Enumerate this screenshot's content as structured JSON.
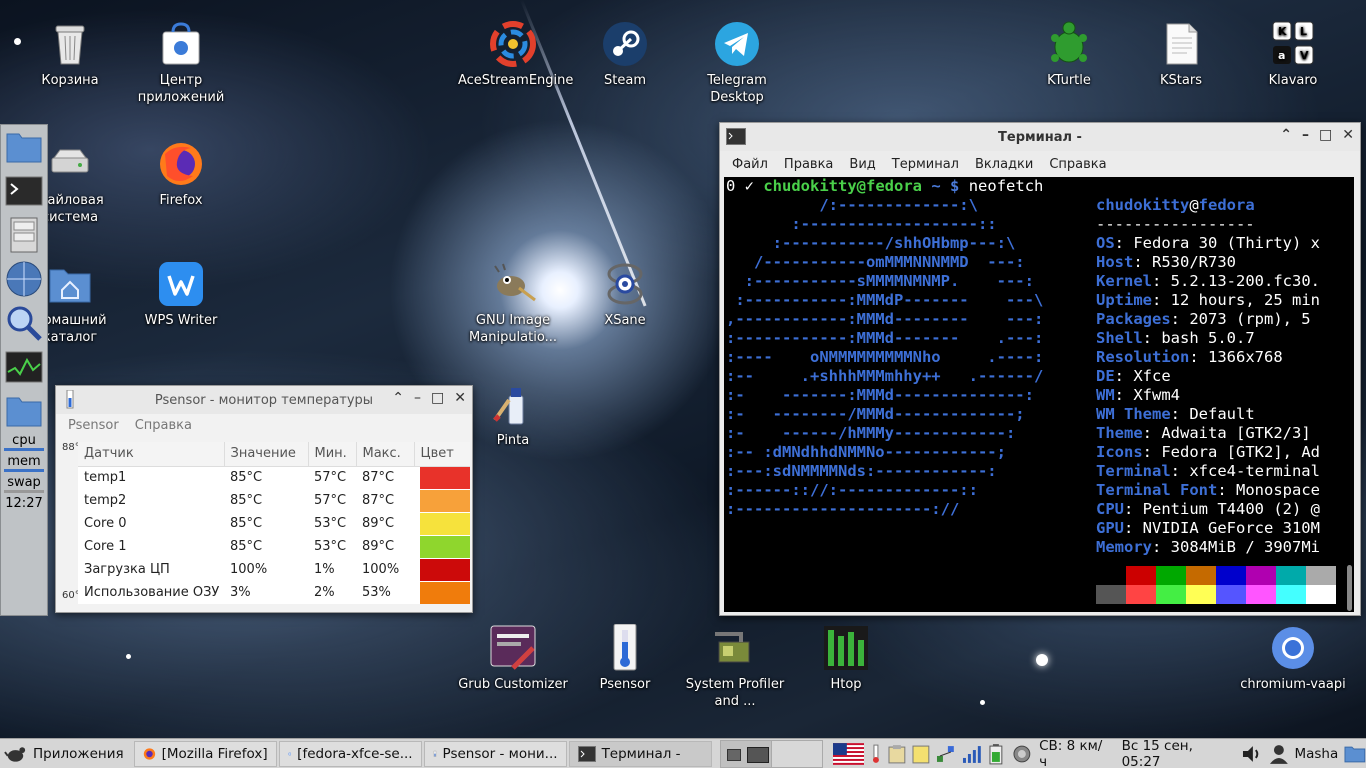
{
  "desktop": {
    "icons": [
      {
        "label": "Корзина",
        "icon": "trash-icon"
      },
      {
        "label": "Центр приложений",
        "icon": "software-center-icon"
      },
      {
        "label": "AceStreamEngine",
        "icon": "acestream-icon"
      },
      {
        "label": "Steam",
        "icon": "steam-icon"
      },
      {
        "label": "Telegram Desktop",
        "icon": "telegram-icon"
      },
      {
        "label": "KTurtle",
        "icon": "kturtle-icon"
      },
      {
        "label": "KStars",
        "icon": "kstars-icon"
      },
      {
        "label": "Klavaro",
        "icon": "klavaro-icon"
      },
      {
        "label": "Файловая система",
        "icon": "drive-icon"
      },
      {
        "label": "Firefox",
        "icon": "firefox-icon"
      },
      {
        "label": "Домашний каталог",
        "icon": "home-folder-icon"
      },
      {
        "label": "WPS Writer",
        "icon": "wps-writer-icon"
      },
      {
        "label": "GNU Image Manipulatio...",
        "icon": "gimp-icon"
      },
      {
        "label": "XSane",
        "icon": "xsane-icon"
      },
      {
        "label": "Pinta",
        "icon": "pinta-icon"
      },
      {
        "label": "Grub Customizer",
        "icon": "grub-customizer-icon"
      },
      {
        "label": "Psensor",
        "icon": "psensor-icon"
      },
      {
        "label": "System Profiler and ...",
        "icon": "system-profiler-icon"
      },
      {
        "label": "Htop",
        "icon": "htop-icon"
      },
      {
        "label": "chromium-vaapi",
        "icon": "chromium-icon"
      }
    ]
  },
  "left_panel": {
    "cpu_label": "cpu",
    "mem_label": "mem",
    "swap_label": "swap",
    "clock": "12:27"
  },
  "psensor": {
    "title": "Psensor - монитор температуры",
    "menu": [
      "Psensor",
      "Справка"
    ],
    "graph_label_top": "88°",
    "graph_label_bottom": "60°",
    "columns": [
      "Датчик",
      "Значение",
      "Мин.",
      "Макс.",
      "Цвет"
    ],
    "rows": [
      {
        "sensor": "temp1",
        "value": "85°C",
        "min": "57°C",
        "max": "87°C",
        "color": "#e8322a"
      },
      {
        "sensor": "temp2",
        "value": "85°C",
        "min": "57°C",
        "max": "87°C",
        "color": "#f7a13a"
      },
      {
        "sensor": "Core 0",
        "value": "85°C",
        "min": "53°C",
        "max": "89°C",
        "color": "#f6e23c"
      },
      {
        "sensor": "Core 1",
        "value": "85°C",
        "min": "53°C",
        "max": "89°C",
        "color": "#8fd62d"
      },
      {
        "sensor": "Загрузка ЦП",
        "value": "100%",
        "min": "1%",
        "max": "100%",
        "color": "#cc0a0a"
      },
      {
        "sensor": "Использование ОЗУ",
        "value": "3%",
        "min": "2%",
        "max": "53%",
        "color": "#f07c0c"
      }
    ]
  },
  "terminal": {
    "title": "Терминал -",
    "menu": [
      "Файл",
      "Правка",
      "Вид",
      "Терминал",
      "Вкладки",
      "Справка"
    ],
    "prompt": {
      "status": "0 ✓",
      "userhost": "chudokitty@fedora",
      "path": "~",
      "symbol": "$",
      "command": "neofetch"
    },
    "logo": [
      "          /:-------------:\\",
      "       :-------------------::",
      "     :-----------/shhOHbmp---:\\",
      "   /-----------omMMMNNNMMD  ---:",
      "  :-----------sMMMMNMNMP.    ---:",
      " :-----------:MMMdP-------    ---\\",
      ",------------:MMMd--------    ---:",
      ":------------:MMMd-------    .---:",
      ":----    oNMMMMMMMMMNho     .----:",
      ":--     .+shhhMMMmhhy++   .------/",
      ":-    -------:MMMd--------------:",
      ":-   --------/MMMd-------------;",
      ":-    ------/hMMMy------------:",
      ":-- :dMNdhhdNMMNo------------;",
      ":---:sdNMMMMNds:------------:",
      ":------:://:-------------::",
      ":---------------------://"
    ],
    "info_user": "chudokitty",
    "info_at": "@",
    "info_host": "fedora",
    "info_sep": "-----------------",
    "info": [
      {
        "key": "OS",
        "value": "Fedora 30 (Thirty) x"
      },
      {
        "key": "Host",
        "value": "R530/R730"
      },
      {
        "key": "Kernel",
        "value": "5.2.13-200.fc30."
      },
      {
        "key": "Uptime",
        "value": "12 hours, 25 min"
      },
      {
        "key": "Packages",
        "value": "2073 (rpm), 5"
      },
      {
        "key": "Shell",
        "value": "bash 5.0.7"
      },
      {
        "key": "Resolution",
        "value": "1366x768"
      },
      {
        "key": "DE",
        "value": "Xfce"
      },
      {
        "key": "WM",
        "value": "Xfwm4"
      },
      {
        "key": "WM Theme",
        "value": "Default"
      },
      {
        "key": "Theme",
        "value": "Adwaita [GTK2/3]"
      },
      {
        "key": "Icons",
        "value": "Fedora [GTK2], Ad"
      },
      {
        "key": "Terminal",
        "value": "xfce4-terminal"
      },
      {
        "key": "Terminal Font",
        "value": "Monospace"
      },
      {
        "key": "CPU",
        "value": "Pentium T4400 (2) @"
      },
      {
        "key": "GPU",
        "value": "NVIDIA GeForce 310M"
      },
      {
        "key": "Memory",
        "value": "3084MiB / 3907Mi"
      }
    ],
    "palette": [
      "#000000",
      "#cc0000",
      "#00a800",
      "#c56a00",
      "#0000cc",
      "#b000b0",
      "#00aaaa",
      "#aaaaaa",
      "#555555",
      "#ff4444",
      "#44ee44",
      "#ffff55",
      "#5555ff",
      "#ff55ff",
      "#44ffff",
      "#ffffff"
    ]
  },
  "taskbar": {
    "apps_label": "Приложения",
    "tasks": [
      {
        "label": "[Mozilla Firefox]",
        "icon": "firefox-icon"
      },
      {
        "label": "[fedora-xfce-se...",
        "icon": "chromium-icon"
      },
      {
        "label": "Psensor - мони...",
        "icon": "psensor-icon"
      },
      {
        "label": "Терминал -",
        "icon": "terminal-icon"
      }
    ],
    "wind": "СВ: 8 км/ч",
    "datetime": "Вс 15 сен, 05:27",
    "user": "Masha"
  }
}
